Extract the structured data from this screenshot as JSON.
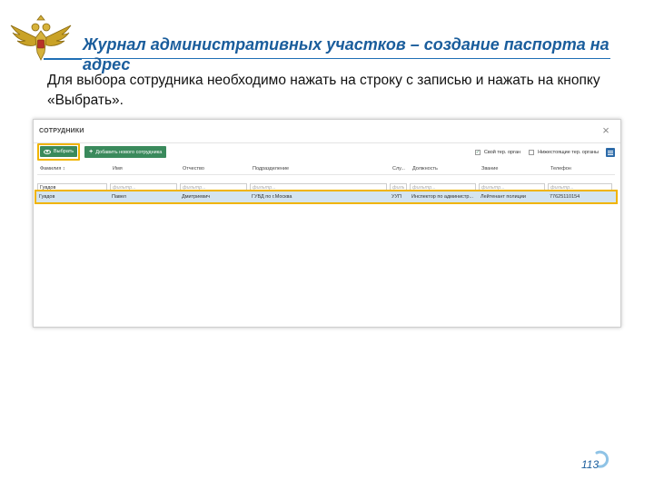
{
  "slide": {
    "title": "Журнал административных участков – создание паспорта на адрес",
    "instruction": "Для выбора сотрудника необходимо нажать на строку с записью и нажать на кнопку «Выбрать».",
    "page_number": "113"
  },
  "dialog": {
    "title": "СОТРУДНИКИ",
    "close_label": "×",
    "toolbar": {
      "select_label": "Выбрать",
      "add_label": "Добавить нового сотрудника"
    },
    "filters": {
      "own_org_label": "Свой тер. орган",
      "sub_orgs_label": "Нижестоящие тер. органы"
    },
    "table": {
      "columns": [
        "Фамилия ↕",
        "Имя",
        "Отчество",
        "Подразделение",
        "Слу...",
        "Должность",
        "Звание",
        "Телефон"
      ],
      "filter_values": [
        "Гувдов",
        "",
        "",
        "",
        "",
        "",
        "",
        ""
      ],
      "filter_placeholders": [
        "фильтр...",
        "фильтр...",
        "фильтр...",
        "фильтр...",
        "фильт",
        "фильтр...",
        "фильтр...",
        "фильтр..."
      ],
      "rows": [
        [
          "Гувдов",
          "Павел",
          "Дмитриевич",
          "ГУВД по г.Москва",
          "УУП",
          "Инспектор по администр...",
          "Лейтенант полиции",
          "77625110154"
        ]
      ]
    }
  },
  "colors": {
    "title_blue": "#1a5d9c",
    "highlight_yellow": "#f0b400",
    "button_green": "#3a8a5c",
    "selected_row": "#d4e4ef"
  }
}
